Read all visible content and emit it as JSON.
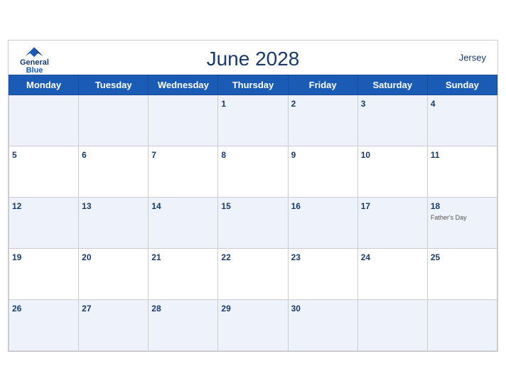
{
  "header": {
    "title": "June 2028",
    "region": "Jersey",
    "logo": {
      "line1": "General",
      "line2": "Blue"
    }
  },
  "weekdays": [
    "Monday",
    "Tuesday",
    "Wednesday",
    "Thursday",
    "Friday",
    "Saturday",
    "Sunday"
  ],
  "weeks": [
    [
      null,
      null,
      null,
      {
        "day": 1
      },
      {
        "day": 2
      },
      {
        "day": 3
      },
      {
        "day": 4
      }
    ],
    [
      {
        "day": 5
      },
      {
        "day": 6
      },
      {
        "day": 7
      },
      {
        "day": 8
      },
      {
        "day": 9
      },
      {
        "day": 10
      },
      {
        "day": 11
      }
    ],
    [
      {
        "day": 12
      },
      {
        "day": 13
      },
      {
        "day": 14
      },
      {
        "day": 15
      },
      {
        "day": 16
      },
      {
        "day": 17
      },
      {
        "day": 18,
        "event": "Father's Day"
      }
    ],
    [
      {
        "day": 19
      },
      {
        "day": 20
      },
      {
        "day": 21
      },
      {
        "day": 22
      },
      {
        "day": 23
      },
      {
        "day": 24
      },
      {
        "day": 25
      }
    ],
    [
      {
        "day": 26
      },
      {
        "day": 27
      },
      {
        "day": 28
      },
      {
        "day": 29
      },
      {
        "day": 30
      },
      null,
      null
    ]
  ]
}
